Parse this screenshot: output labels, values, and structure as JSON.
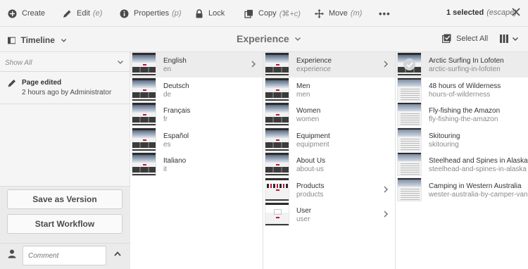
{
  "actions": {
    "create": "Create",
    "edit": "Edit",
    "edit_key": "(e)",
    "properties": "Properties",
    "properties_key": "(p)",
    "lock": "Lock",
    "copy": "Copy",
    "copy_key": "(⌘+c)",
    "move": "Move",
    "move_key": "(m)",
    "more": "•••",
    "selected": "1 selected",
    "selected_key": "(escape)"
  },
  "header": {
    "rail_label": "Timeline",
    "breadcrumb": "Experience",
    "select_all": "Select All"
  },
  "timeline": {
    "filter": "Show All",
    "event_title": "Page edited",
    "event_meta": "2 hours ago by Administrator",
    "save_version": "Save as Version",
    "start_workflow": "Start Workflow",
    "comment_placeholder": "Comment"
  },
  "columns": [
    {
      "items": [
        {
          "title": "English",
          "name": "en",
          "active": true,
          "has_children": true
        },
        {
          "title": "Deutsch",
          "name": "de"
        },
        {
          "title": "Français",
          "name": "fr"
        },
        {
          "title": "Español",
          "name": "es"
        },
        {
          "title": "Italiano",
          "name": "it"
        }
      ]
    },
    {
      "items": [
        {
          "title": "Experience",
          "name": "experience",
          "active": true,
          "has_children": true
        },
        {
          "title": "Men",
          "name": "men"
        },
        {
          "title": "Women",
          "name": "women"
        },
        {
          "title": "Equipment",
          "name": "equipment"
        },
        {
          "title": "About Us",
          "name": "about-us"
        },
        {
          "title": "Products",
          "name": "products",
          "has_children": true
        },
        {
          "title": "User",
          "name": "user",
          "has_children": true
        }
      ]
    },
    {
      "items": [
        {
          "title": "Arctic Surfing In Lofoten",
          "name": "arctic-surfing-in-lofoten",
          "selected": true
        },
        {
          "title": "48 hours of Wilderness",
          "name": "hours-of-wilderness"
        },
        {
          "title": "Fly-fishing the Amazon",
          "name": "fly-fishing-the-amazon"
        },
        {
          "title": "Skitouring",
          "name": "skitouring"
        },
        {
          "title": "Steelhead and Spines in Alaska",
          "name": "steelhead-and-spines-in-alaska"
        },
        {
          "title": "Camping in Western Australia",
          "name": "wester-australia-by-camper-van"
        }
      ]
    }
  ],
  "colors": {
    "bar_bg": "#f4f4f4",
    "rail_bg": "#f5f5f5",
    "active_row": "#ececec",
    "accent_red": "#c8102e"
  }
}
